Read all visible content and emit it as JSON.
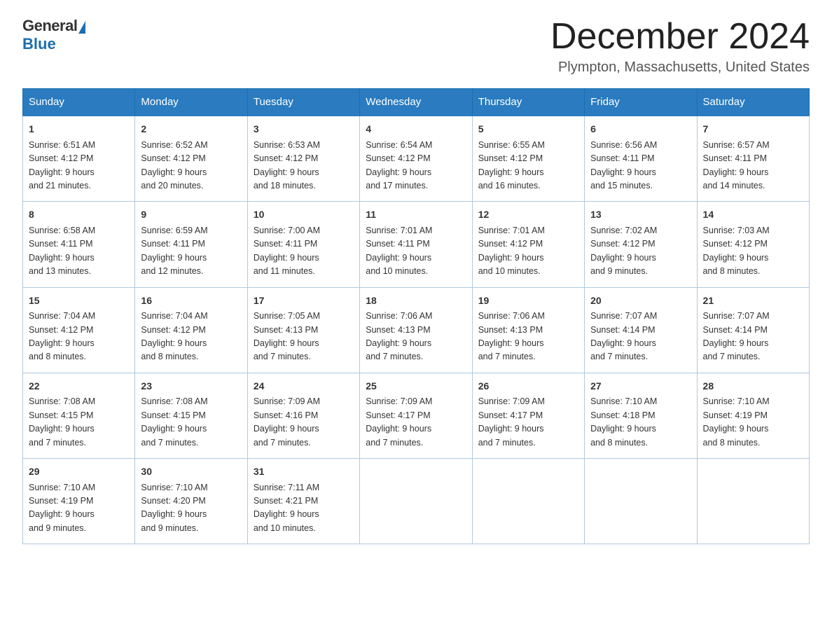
{
  "logo": {
    "general": "General",
    "blue": "Blue"
  },
  "title": "December 2024",
  "subtitle": "Plympton, Massachusetts, United States",
  "weekdays": [
    "Sunday",
    "Monday",
    "Tuesday",
    "Wednesday",
    "Thursday",
    "Friday",
    "Saturday"
  ],
  "weeks": [
    [
      {
        "day": "1",
        "sunrise": "6:51 AM",
        "sunset": "4:12 PM",
        "daylight": "9 hours and 21 minutes."
      },
      {
        "day": "2",
        "sunrise": "6:52 AM",
        "sunset": "4:12 PM",
        "daylight": "9 hours and 20 minutes."
      },
      {
        "day": "3",
        "sunrise": "6:53 AM",
        "sunset": "4:12 PM",
        "daylight": "9 hours and 18 minutes."
      },
      {
        "day": "4",
        "sunrise": "6:54 AM",
        "sunset": "4:12 PM",
        "daylight": "9 hours and 17 minutes."
      },
      {
        "day": "5",
        "sunrise": "6:55 AM",
        "sunset": "4:12 PM",
        "daylight": "9 hours and 16 minutes."
      },
      {
        "day": "6",
        "sunrise": "6:56 AM",
        "sunset": "4:11 PM",
        "daylight": "9 hours and 15 minutes."
      },
      {
        "day": "7",
        "sunrise": "6:57 AM",
        "sunset": "4:11 PM",
        "daylight": "9 hours and 14 minutes."
      }
    ],
    [
      {
        "day": "8",
        "sunrise": "6:58 AM",
        "sunset": "4:11 PM",
        "daylight": "9 hours and 13 minutes."
      },
      {
        "day": "9",
        "sunrise": "6:59 AM",
        "sunset": "4:11 PM",
        "daylight": "9 hours and 12 minutes."
      },
      {
        "day": "10",
        "sunrise": "7:00 AM",
        "sunset": "4:11 PM",
        "daylight": "9 hours and 11 minutes."
      },
      {
        "day": "11",
        "sunrise": "7:01 AM",
        "sunset": "4:11 PM",
        "daylight": "9 hours and 10 minutes."
      },
      {
        "day": "12",
        "sunrise": "7:01 AM",
        "sunset": "4:12 PM",
        "daylight": "9 hours and 10 minutes."
      },
      {
        "day": "13",
        "sunrise": "7:02 AM",
        "sunset": "4:12 PM",
        "daylight": "9 hours and 9 minutes."
      },
      {
        "day": "14",
        "sunrise": "7:03 AM",
        "sunset": "4:12 PM",
        "daylight": "9 hours and 8 minutes."
      }
    ],
    [
      {
        "day": "15",
        "sunrise": "7:04 AM",
        "sunset": "4:12 PM",
        "daylight": "9 hours and 8 minutes."
      },
      {
        "day": "16",
        "sunrise": "7:04 AM",
        "sunset": "4:12 PM",
        "daylight": "9 hours and 8 minutes."
      },
      {
        "day": "17",
        "sunrise": "7:05 AM",
        "sunset": "4:13 PM",
        "daylight": "9 hours and 7 minutes."
      },
      {
        "day": "18",
        "sunrise": "7:06 AM",
        "sunset": "4:13 PM",
        "daylight": "9 hours and 7 minutes."
      },
      {
        "day": "19",
        "sunrise": "7:06 AM",
        "sunset": "4:13 PM",
        "daylight": "9 hours and 7 minutes."
      },
      {
        "day": "20",
        "sunrise": "7:07 AM",
        "sunset": "4:14 PM",
        "daylight": "9 hours and 7 minutes."
      },
      {
        "day": "21",
        "sunrise": "7:07 AM",
        "sunset": "4:14 PM",
        "daylight": "9 hours and 7 minutes."
      }
    ],
    [
      {
        "day": "22",
        "sunrise": "7:08 AM",
        "sunset": "4:15 PM",
        "daylight": "9 hours and 7 minutes."
      },
      {
        "day": "23",
        "sunrise": "7:08 AM",
        "sunset": "4:15 PM",
        "daylight": "9 hours and 7 minutes."
      },
      {
        "day": "24",
        "sunrise": "7:09 AM",
        "sunset": "4:16 PM",
        "daylight": "9 hours and 7 minutes."
      },
      {
        "day": "25",
        "sunrise": "7:09 AM",
        "sunset": "4:17 PM",
        "daylight": "9 hours and 7 minutes."
      },
      {
        "day": "26",
        "sunrise": "7:09 AM",
        "sunset": "4:17 PM",
        "daylight": "9 hours and 7 minutes."
      },
      {
        "day": "27",
        "sunrise": "7:10 AM",
        "sunset": "4:18 PM",
        "daylight": "9 hours and 8 minutes."
      },
      {
        "day": "28",
        "sunrise": "7:10 AM",
        "sunset": "4:19 PM",
        "daylight": "9 hours and 8 minutes."
      }
    ],
    [
      {
        "day": "29",
        "sunrise": "7:10 AM",
        "sunset": "4:19 PM",
        "daylight": "9 hours and 9 minutes."
      },
      {
        "day": "30",
        "sunrise": "7:10 AM",
        "sunset": "4:20 PM",
        "daylight": "9 hours and 9 minutes."
      },
      {
        "day": "31",
        "sunrise": "7:11 AM",
        "sunset": "4:21 PM",
        "daylight": "9 hours and 10 minutes."
      },
      null,
      null,
      null,
      null
    ]
  ],
  "labels": {
    "sunrise": "Sunrise:",
    "sunset": "Sunset:",
    "daylight": "Daylight:"
  }
}
